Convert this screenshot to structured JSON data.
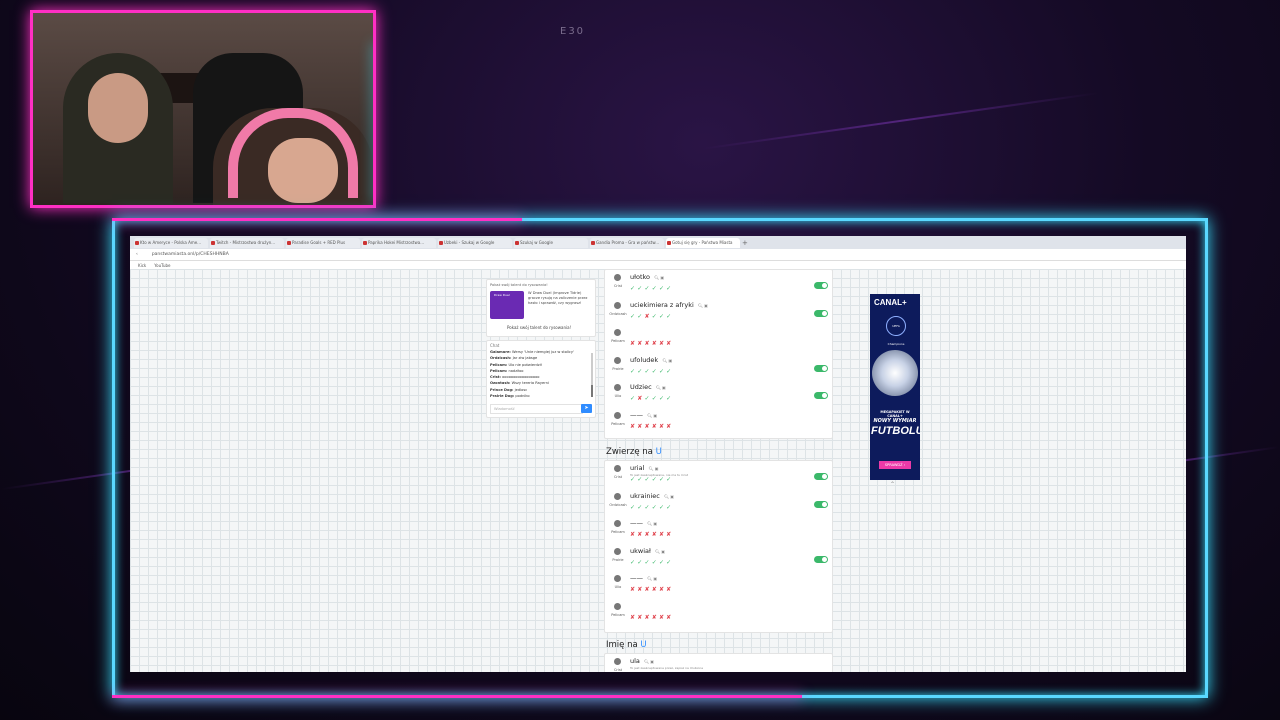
{
  "overlay": {
    "episode_tag": "E30"
  },
  "browser": {
    "tabs": [
      {
        "label": "Kto w Ameryce - Polska Ame..."
      },
      {
        "label": "Twitch - Mistrzostwa drużyn..."
      },
      {
        "label": "Paradise Goals + RED Plus"
      },
      {
        "label": "Paprika Hokei Mistrzostwa..."
      },
      {
        "label": "Uzbeki - Szukaj w Google"
      },
      {
        "label": "Szukaj w Google"
      },
      {
        "label": "Gandia Proma - Gra w państw..."
      },
      {
        "label": "Gotuj się gry - Państwa Miasta"
      }
    ],
    "new_tab": "+",
    "url": "panstwamiasta.onl/p/CHESHHNBA",
    "bookmarks": [
      "Kick",
      "YouTube"
    ]
  },
  "promo": {
    "title": "Pokaż swój talent do rysowania!",
    "image_label": "Draw Duel",
    "text": "W Draw Duel (Improve Tidrie) gracze rysują na zaliczenie przez hasło i sprawdź, czy wygrasz!",
    "button": "Pokaż swój talent do rysowania!"
  },
  "chat": {
    "label": "Chat",
    "messages": [
      {
        "user": "Gaiamare:",
        "text": "Wersy 'Unie niemgiej juz w stolicy'"
      },
      {
        "user": "Ordzicash:",
        "text": "Jar ziw jabsge"
      },
      {
        "user": "Pelicam:",
        "text": "Ulo nie potwierdził"
      },
      {
        "user": "Pelicam:",
        "text": "nadziłoo"
      },
      {
        "user": "Crist:",
        "text": "ooooooooooooooooo"
      },
      {
        "user": "Ozontash:",
        "text": "Wszy tereria Rayerni"
      },
      {
        "user": "Prince Dog:",
        "text": "jedlosc"
      },
      {
        "user": "Prairie Dog:",
        "text": "podniko"
      }
    ],
    "input_placeholder": "Wiadomość",
    "send_icon": "send-icon"
  },
  "sections": {
    "top": {
      "rows": [
        {
          "player": "Crist",
          "answer": "ułotko",
          "note": "",
          "votes": "✓✓✓✓✓✓",
          "toggle": true
        },
        {
          "player": "Ordzicash",
          "answer": "uciekimiera z afryki",
          "note": "",
          "votes": "✓✓✘✓✓✓",
          "toggle": true
        },
        {
          "player": "Pelicam",
          "answer": "",
          "note": "",
          "votes": "✘✘✘✘✘✘",
          "toggle": false
        },
        {
          "player": "Prairie",
          "answer": "ufoludek",
          "note": "",
          "votes": "✓✓✓✓✓✓",
          "toggle": true
        },
        {
          "player": "Ulio",
          "answer": "Udziec",
          "note": "",
          "votes": "✓✘✓✓✓✓",
          "toggle": true
        },
        {
          "player": "Pelicam",
          "answer": "——",
          "note": "",
          "votes": "✘✘✘✘✘✘",
          "toggle": false
        }
      ]
    },
    "zwierze": {
      "title": "Zwierzę na",
      "letter": "U",
      "rows": [
        {
          "player": "Crist",
          "answer": "urial",
          "note": "To jest zaakceptowane, nie ma tu Crist",
          "votes": "✓✓✓✓✓✓",
          "toggle": true
        },
        {
          "player": "Ordzicash",
          "answer": "ukrainiec",
          "note": "",
          "votes": "✓✓✓✓✓✓",
          "toggle": true
        },
        {
          "player": "Pelicam",
          "answer": "——",
          "note": "",
          "votes": "✘✘✘✘✘✘",
          "toggle": false
        },
        {
          "player": "Prairie",
          "answer": "ukwiał",
          "note": "",
          "votes": "✓✓✓✓✓✓",
          "toggle": true
        },
        {
          "player": "Ulio",
          "answer": "——",
          "note": "",
          "votes": "✘✘✘✘✘✘",
          "toggle": false
        },
        {
          "player": "Pelicam",
          "answer": "",
          "note": "",
          "votes": "✘✘✘✘✘✘",
          "toggle": false
        }
      ]
    },
    "imie": {
      "title": "Imię na",
      "letter": "U",
      "rows": [
        {
          "player": "Crist",
          "answer": "ula",
          "note": "To jest zaakceptowane przez, zapisz na Ulubione",
          "votes": "",
          "toggle": false
        }
      ]
    }
  },
  "ad": {
    "brand": "CANAL+",
    "ucl": "UEFA Champions League",
    "line1": "MEGAPAKIET W CANAL+",
    "line2": "NOWY WYMIAR",
    "line3": "FUTBOLU",
    "button": "SPRAWDŹ ›",
    "collapse": "⌃"
  }
}
